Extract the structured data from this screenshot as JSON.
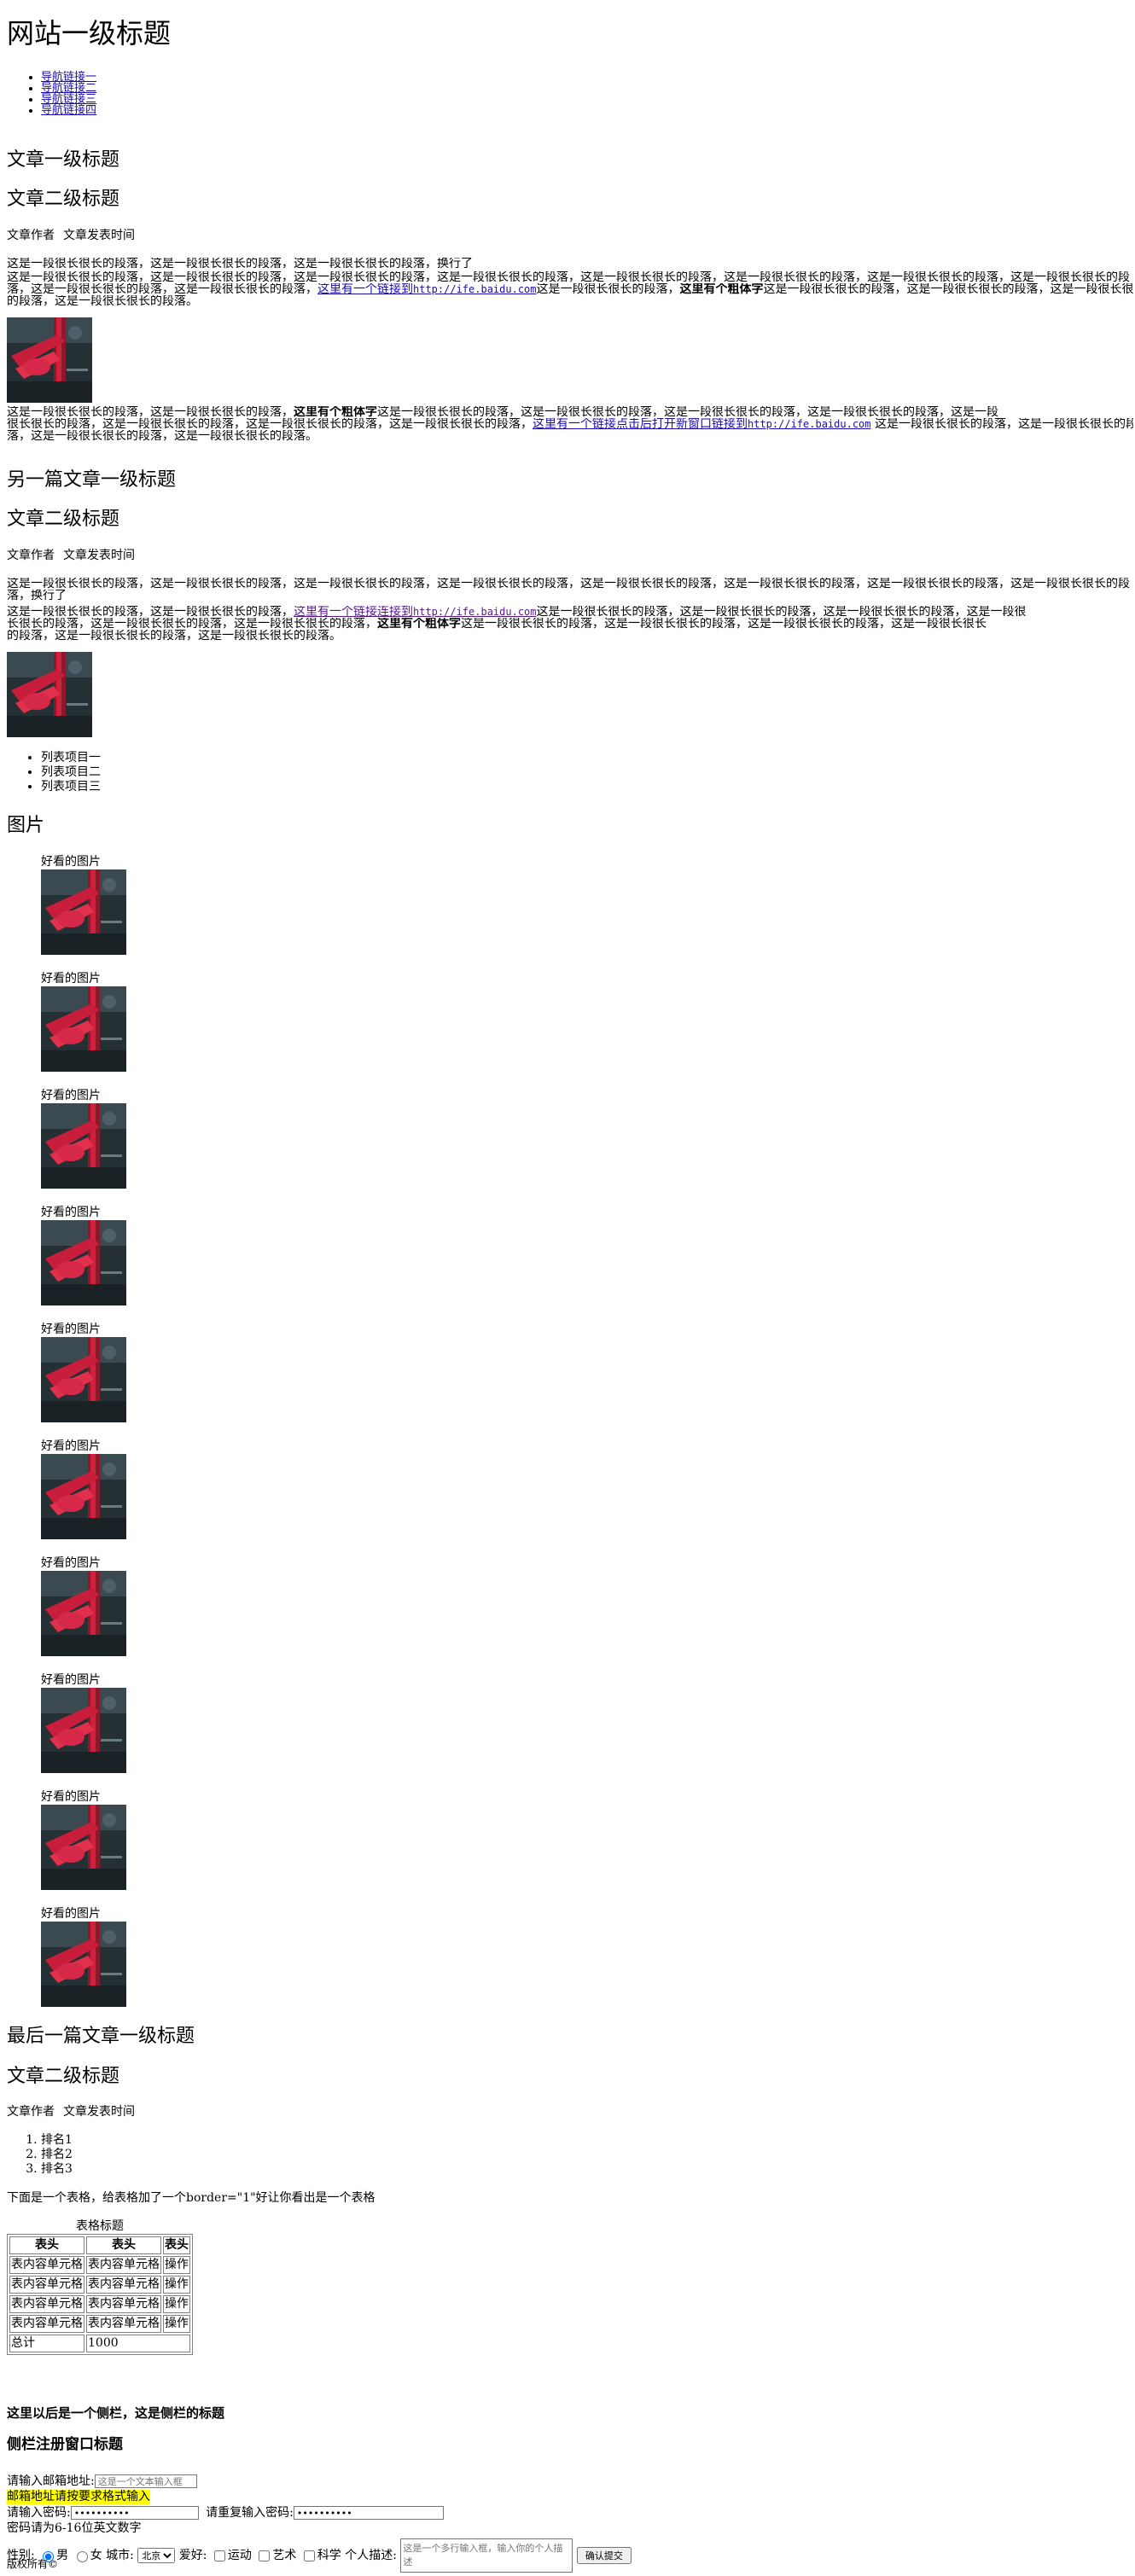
{
  "site_title": "网站一级标题",
  "nav": [
    "导航链接一",
    "导航链接二",
    "导航链接三",
    "导航链接四"
  ],
  "article1": {
    "h1": "文章一级标题",
    "h2": "文章二级标题",
    "author": "文章作者",
    "time": "文章发表时间",
    "p1": "这是一段很长很长的段落，这是一段很长很长的段落，这是一段很长很长的段落，换行了",
    "p2_line1_a": "这是一段很长很长的段落，这是一段很长很长的段落，这是一段很长很长的段落，这是一段很长很长的段落，这是一段很长很长的段落，这是一段很长很长的段落，这是一段很长很长的段落，这是一段很长很长的段",
    "p2_line2_a": "落，这是一段很长很长的段落，这是一段很长很长的段落，",
    "p2_link": "这里有一个链接到",
    "p2_link_url": "http://ife.baidu.com",
    "p2_line2_b": "这是一段很长很长的段落，",
    "p2_bold": "这里有个粗体字",
    "p2_line2_c": "这是一段很长很长的段落，这是一段很长很长的段落，这是一段很长很长",
    "p2_line3": "的段落，这是一段很长很长的段落。",
    "p3_line1_a": "这是一段很长很长的段落，这是一段很长很长的段落，",
    "p3_bold": "这里有个粗体字",
    "p3_line1_b": "这是一段很长很长的段落，这是一段很长很长的段落，这是一段很长很长的段落，这是一段很长很长的段落，这是一段",
    "p3_line2_a": "很长很长的段落，这是一段很长很长的段落，这是一段很长很长的段落，这是一段很长很长的段落，",
    "p3_link": "这里有一个链接点击后打开新窗口链接到",
    "p3_link_url": "http://ife.baidu.com",
    "p3_line2_b": " 这是一段很长很长的段落，这是一段很长很长的段",
    "p3_line3": "落，这是一段很长很长的段落，这是一段很长很长的段落。"
  },
  "article2": {
    "h1": "另一篇文章一级标题",
    "h2": "文章二级标题",
    "author": "文章作者",
    "time": "文章发表时间",
    "p1_line1": "这是一段很长很长的段落，这是一段很长很长的段落，这是一段很长很长的段落，这是一段很长很长的段落，这是一段很长很长的段落，这是一段很长很长的段落，这是一段很长很长的段落，这是一段很长很长的段",
    "p1_line2": "落，换行了",
    "p2_line1_a": "这是一段很长很长的段落，这是一段很长很长的段落，",
    "p2_link": "这里有一个链接连接到",
    "p2_link_url": "http://ife.baidu.com",
    "p2_line1_b": "这是一段很长很长的段落，这是一段很长很长的段落，这是一段很长很长的段落，这是一段很",
    "p2_line2_a": "长很长的段落，这是一段很长很长的段落，这是一段很长很长的段落，",
    "p2_bold": "这里有个粗体字",
    "p2_line2_b": "这是一段很长很长的段落，这是一段很长很长的段落，这是一段很长很长的段落，这是一段很长很长",
    "p2_line3": "的段落，这是一段很长很长的段落，这是一段很长很长的段落。",
    "list": [
      "列表项目一",
      "列表项目二",
      "列表项目三"
    ]
  },
  "gallery": {
    "title": "图片",
    "caption": "好看的图片",
    "count": 10
  },
  "article3": {
    "h1": "最后一篇文章一级标题",
    "h2": "文章二级标题",
    "author": "文章作者",
    "time": "文章发表时间",
    "ranks": [
      "排名1",
      "排名2",
      "排名3"
    ],
    "table_intro": "下面是一个表格，给表格加了一个border=\"1\"好让你看出是一个表格",
    "table": {
      "caption": "表格标题",
      "headers": [
        "表头",
        "表头",
        "表头"
      ],
      "rows": [
        [
          "表内容单元格",
          "表内容单元格",
          "操作"
        ],
        [
          "表内容单元格",
          "表内容单元格",
          "操作"
        ],
        [
          "表内容单元格",
          "表内容单元格",
          "操作"
        ],
        [
          "表内容单元格",
          "表内容单元格",
          "操作"
        ]
      ],
      "total_label": "总计",
      "total_value": "1000"
    }
  },
  "sidebar": {
    "title": "这里以后是一个侧栏，这是侧栏的标题",
    "register_title": "侧栏注册窗口标题",
    "email_label": "请输入邮箱地址:",
    "email_placeholder": "这是一个文本输入框",
    "email_warning": "邮箱地址请按要求格式输入",
    "password_label": "请输入密码:",
    "password_value": "••••••••••",
    "password2_label": "请重复输入密码:",
    "password2_value": "••••••••••",
    "password_hint": "密码请为6-16位英文数字",
    "gender_label": "性别:",
    "gender_male": "男",
    "gender_female": "女",
    "city_label": "城市:",
    "city_value": "北京",
    "hobby_label": "爱好:",
    "hobbies": [
      "运动",
      "艺术",
      "科学"
    ],
    "desc_label": "个人描述:",
    "desc_placeholder": "这是一个多行输入框，输入你的个人描述",
    "submit": "确认提交"
  },
  "footer": "版权所有©"
}
